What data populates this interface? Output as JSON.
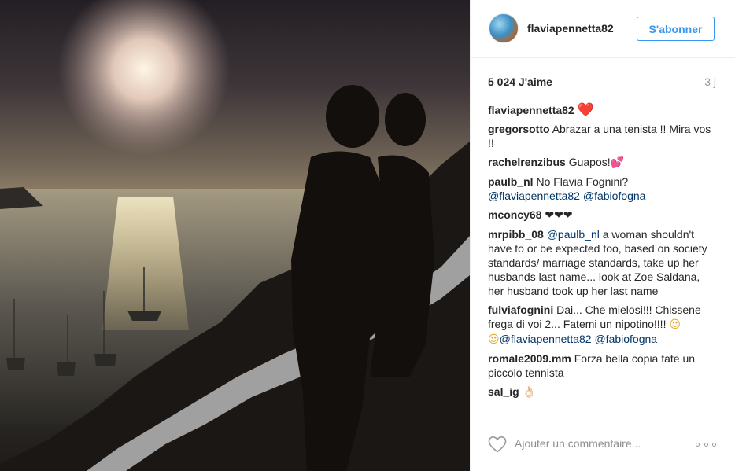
{
  "post": {
    "image_alt": "couple silhouette kissing at sunset above the sea"
  },
  "header": {
    "username": "flaviapennetta82",
    "follow_label": "S'abonner",
    "accent_color": "#3897f0"
  },
  "meta": {
    "likes": "5 024 J'aime",
    "time": "3 j"
  },
  "comments": [
    {
      "user": "flaviapennetta82",
      "text": "",
      "emoji": "❤️"
    },
    {
      "user": "gregorsotto",
      "text": "Abrazar a una tenista !! Mira vos !!"
    },
    {
      "user": "rachelrenzibus",
      "text": "Guapos!",
      "emoji": "💕"
    },
    {
      "user": "paulb_nl",
      "text": "No Flavia Fognini?",
      "mention1": "@flaviapennetta82",
      "mention2": "@fabiofogna"
    },
    {
      "user": "mconcy68",
      "emoji": "❤❤❤"
    },
    {
      "user": "mrpibb_08",
      "mention1": "@paulb_nl",
      "text": "a woman shouldn't have to or be expected too, based on society standards/ marriage standards, take up her husbands last name... look at Zoe Saldana, her husband took up her last name"
    },
    {
      "user": "fulviafognini",
      "text": "Dai... Che mielosi!!! Chissene frega di voi 2... Fatemi un nipotino!!!!",
      "emoji": "😍",
      "emoji2": "😍",
      "mention1": "@flaviapennetta82",
      "mention2": "@fabiofogna"
    },
    {
      "user": "romale2009.mm",
      "text": "Forza bella copia fate un piccolo tennista"
    },
    {
      "user": "sal_ig",
      "emoji": "👌🏻"
    }
  ],
  "footer": {
    "comment_placeholder": "Ajouter un commentaire...",
    "like_icon": "heart-outline-icon",
    "more_icon": "ellipsis-icon"
  }
}
